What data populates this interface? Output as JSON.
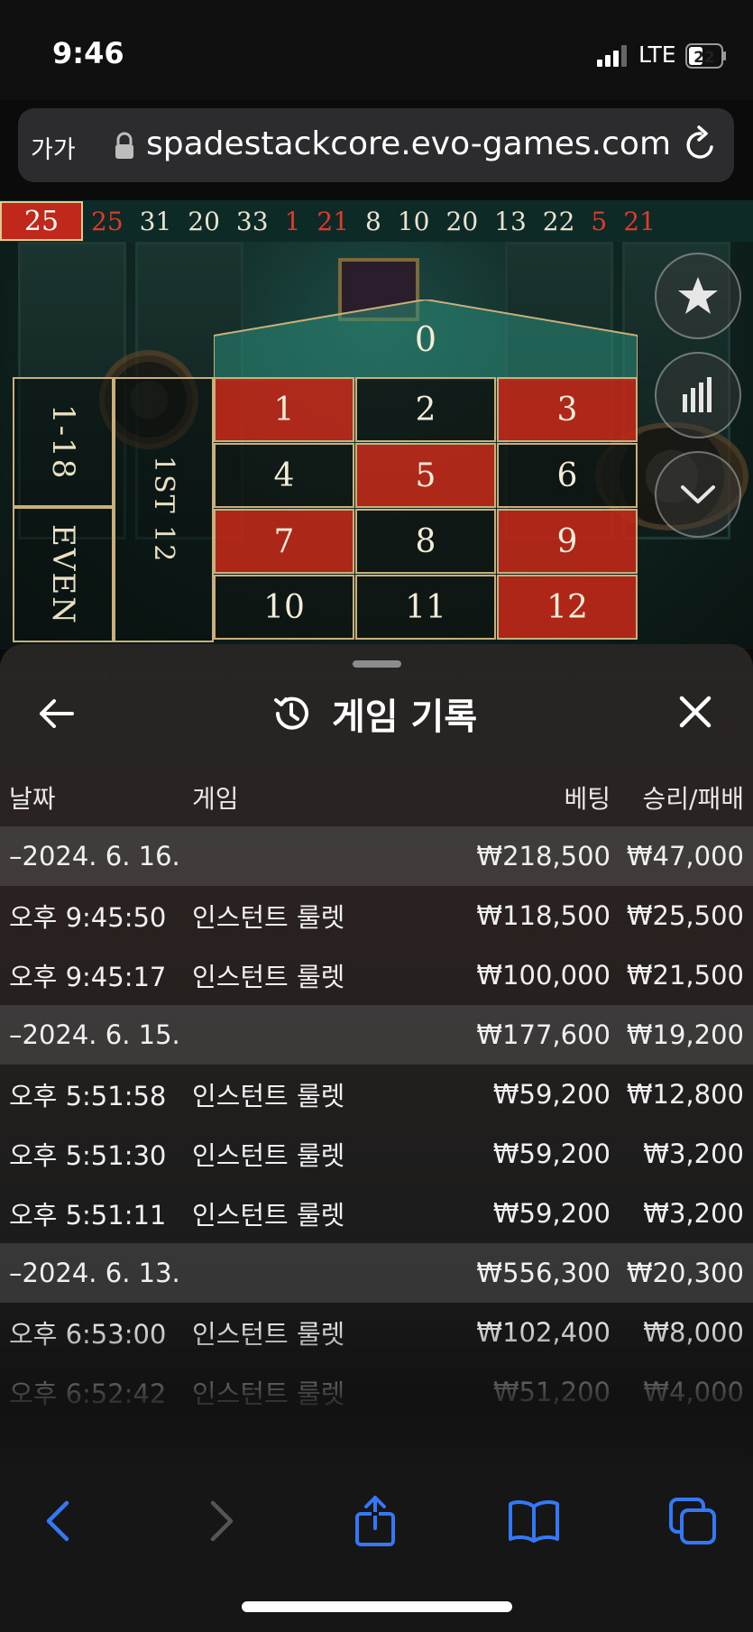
{
  "status": {
    "time": "9:46",
    "network": "LTE",
    "battery": "22"
  },
  "browser": {
    "aa_label": "가가",
    "url": "spadestackcore.evo-games.com"
  },
  "history_strip": {
    "current": "25",
    "numbers": [
      {
        "v": "25",
        "red": true
      },
      {
        "v": "31",
        "red": false
      },
      {
        "v": "20",
        "red": false
      },
      {
        "v": "33",
        "red": false
      },
      {
        "v": "1",
        "red": true
      },
      {
        "v": "21",
        "red": true
      },
      {
        "v": "8",
        "red": false
      },
      {
        "v": "10",
        "red": false
      },
      {
        "v": "20",
        "red": false
      },
      {
        "v": "13",
        "red": false
      },
      {
        "v": "22",
        "red": false
      },
      {
        "v": "5",
        "red": true
      },
      {
        "v": "21",
        "red": true
      }
    ]
  },
  "roulette": {
    "zero": "0",
    "numbers": [
      {
        "v": "1",
        "c": "red"
      },
      {
        "v": "2",
        "c": "black"
      },
      {
        "v": "3",
        "c": "red"
      },
      {
        "v": "4",
        "c": "black"
      },
      {
        "v": "5",
        "c": "red"
      },
      {
        "v": "6",
        "c": "black"
      },
      {
        "v": "7",
        "c": "red"
      },
      {
        "v": "8",
        "c": "black"
      },
      {
        "v": "9",
        "c": "red"
      },
      {
        "v": "10",
        "c": "black"
      },
      {
        "v": "11",
        "c": "black"
      },
      {
        "v": "12",
        "c": "red"
      }
    ],
    "low_label": "1-18",
    "even_label": "EVEN",
    "dozen_label": "1ST 12"
  },
  "sheet": {
    "title": "게임 기록",
    "columns": {
      "date": "날짜",
      "game": "게임",
      "bet": "베팅",
      "winloss": "승리/패배"
    },
    "groups": [
      {
        "date": "–2024. 6. 16.",
        "bet": "₩218,500",
        "winloss": "₩47,000",
        "rows": [
          {
            "time": "오후 9:45:50",
            "game": "인스턴트 룰렛",
            "bet": "₩118,500",
            "winloss": "₩25,500"
          },
          {
            "time": "오후 9:45:17",
            "game": "인스턴트 룰렛",
            "bet": "₩100,000",
            "winloss": "₩21,500"
          }
        ]
      },
      {
        "date": "–2024. 6. 15.",
        "bet": "₩177,600",
        "winloss": "₩19,200",
        "rows": [
          {
            "time": "오후 5:51:58",
            "game": "인스턴트 룰렛",
            "bet": "₩59,200",
            "winloss": "₩12,800"
          },
          {
            "time": "오후 5:51:30",
            "game": "인스턴트 룰렛",
            "bet": "₩59,200",
            "winloss": "₩3,200"
          },
          {
            "time": "오후 5:51:11",
            "game": "인스턴트 룰렛",
            "bet": "₩59,200",
            "winloss": "₩3,200"
          }
        ]
      },
      {
        "date": "–2024. 6. 13.",
        "bet": "₩556,300",
        "winloss": "₩20,300",
        "rows": [
          {
            "time": "오후 6:53:00",
            "game": "인스턴트 룰렛",
            "bet": "₩102,400",
            "winloss": "₩8,000"
          },
          {
            "time": "오후 6:52:42",
            "game": "인스턴트 룰렛",
            "bet": "₩51,200",
            "winloss": "₩4,000"
          }
        ]
      }
    ]
  },
  "colors": {
    "red": "#c4281c",
    "felt": "#1d4a44",
    "accent": "#3478f6",
    "gold": "#c9b07a"
  }
}
